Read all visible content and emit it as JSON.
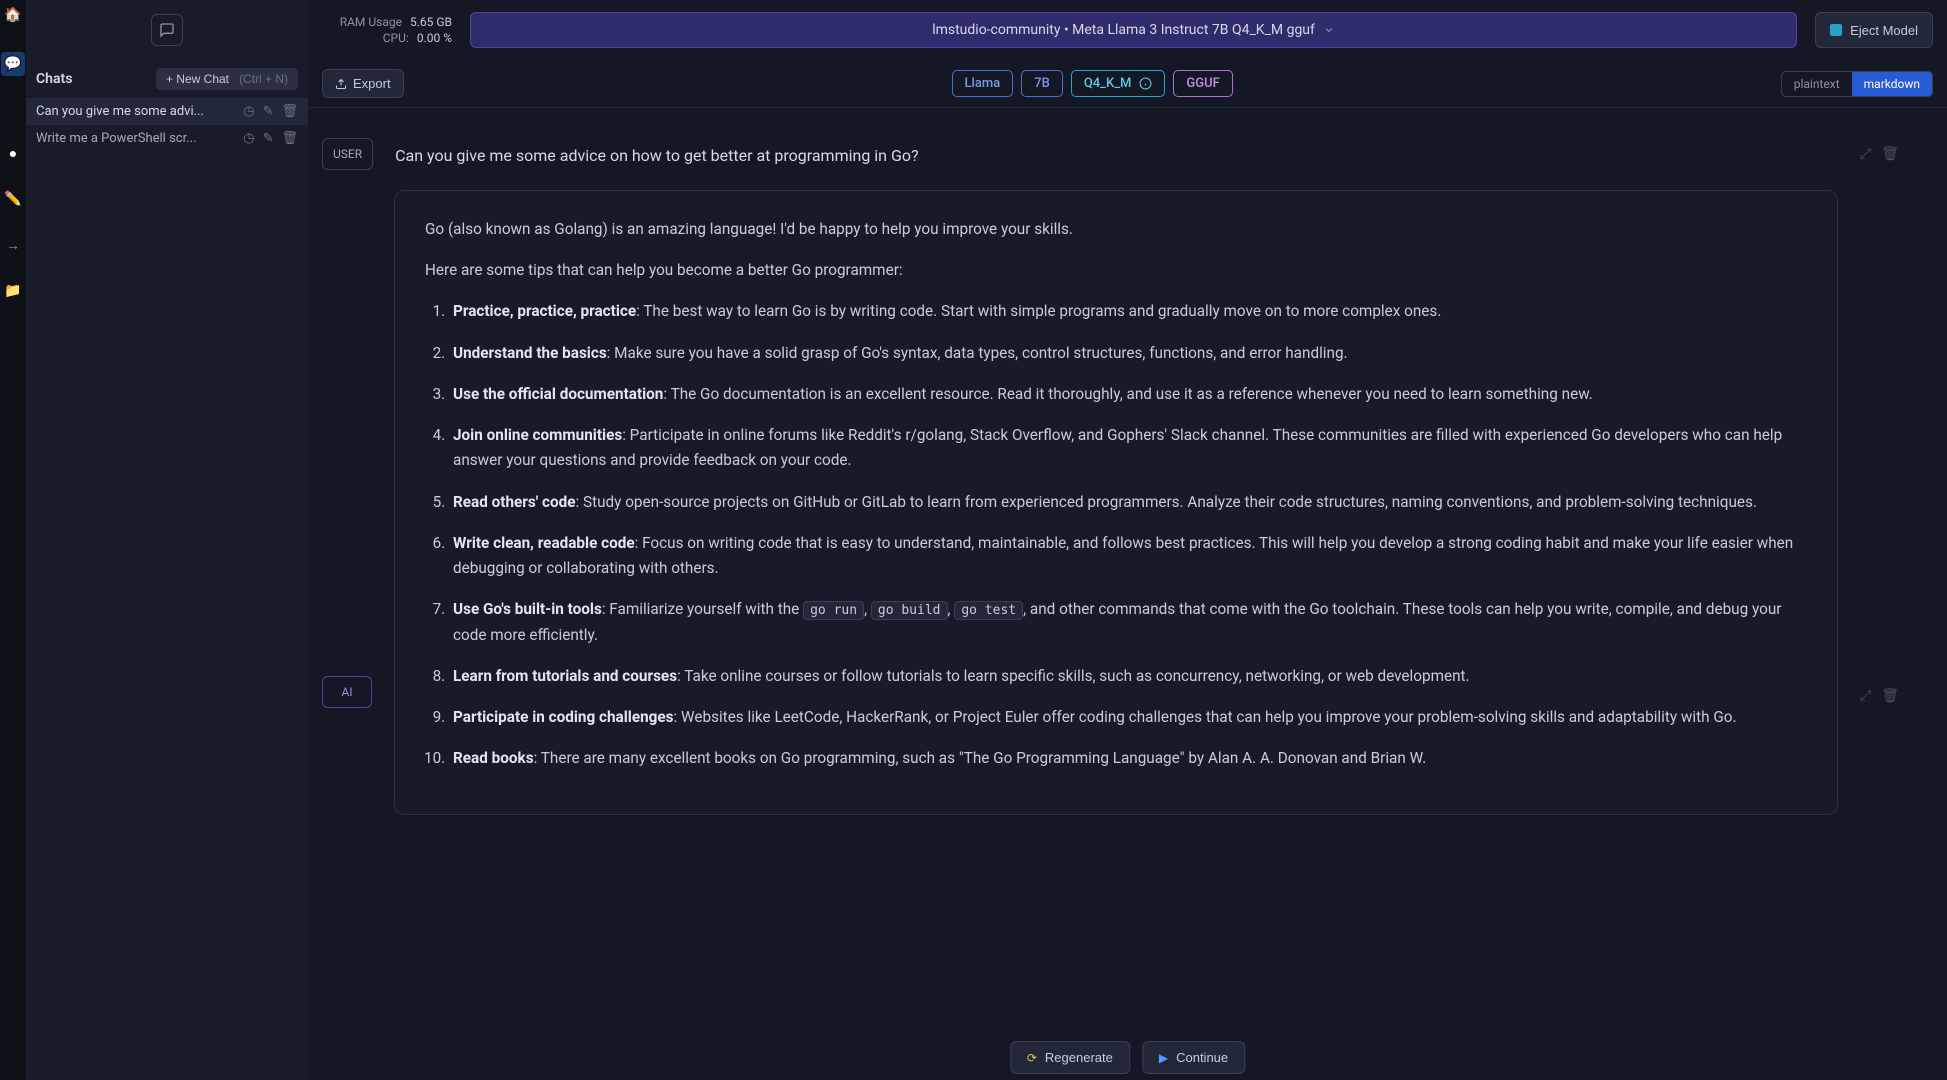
{
  "rail": {
    "items": [
      {
        "name": "home-icon",
        "glyph": "🏠"
      },
      {
        "name": "chat-icon",
        "glyph": "💬",
        "active": true
      },
      {
        "name": "bulb-icon",
        "glyph": "💡"
      },
      {
        "name": "edit-icon",
        "glyph": "✏️"
      },
      {
        "name": "arrow-icon",
        "glyph": "→"
      },
      {
        "name": "folder-icon",
        "glyph": "📁"
      }
    ]
  },
  "sidebar": {
    "title": "Chats",
    "new_chat_label": "+ New Chat",
    "new_chat_kbd": "(Ctrl + N)",
    "items": [
      {
        "label": "Can you give me some advi...",
        "active": true
      },
      {
        "label": "Write me a PowerShell scr..."
      }
    ]
  },
  "header": {
    "ram_label": "RAM Usage",
    "ram_value": "5.65 GB",
    "cpu_label": "CPU:",
    "cpu_value": "0.00 %",
    "model_label": "lmstudio-community • Meta Llama 3 Instruct 7B Q4_K_M gguf",
    "eject_label": "Eject Model"
  },
  "tags": {
    "export_label": "Export",
    "llama": "Llama",
    "sevenb": "7B",
    "quant": "Q4_K_M",
    "gguf": "GGUF",
    "view_plaintext": "plaintext",
    "view_markdown": "markdown"
  },
  "conversation": {
    "user_role": "USER",
    "ai_role": "AI",
    "user_text": "Can you give me some advice on how to get better at programming in Go?",
    "ai_intro1": "Go (also known as Golang) is an amazing language! I'd be happy to help you improve your skills.",
    "ai_intro2": "Here are some tips that can help you become a better Go programmer:",
    "tips": [
      {
        "title": "Practice, practice, practice",
        "body": ": The best way to learn Go is by writing code. Start with simple programs and gradually move on to more complex ones."
      },
      {
        "title": "Understand the basics",
        "body": ": Make sure you have a solid grasp of Go's syntax, data types, control structures, functions, and error handling."
      },
      {
        "title": "Use the official documentation",
        "body": ": The Go documentation is an excellent resource. Read it thoroughly, and use it as a reference whenever you need to learn something new."
      },
      {
        "title": "Join online communities",
        "body": ": Participate in online forums like Reddit's r/golang, Stack Overflow, and Gophers' Slack channel. These communities are filled with experienced Go developers who can help answer your questions and provide feedback on your code."
      },
      {
        "title": "Read others' code",
        "body": ": Study open-source projects on GitHub or GitLab to learn from experienced programmers. Analyze their code structures, naming conventions, and problem-solving techniques."
      },
      {
        "title": "Write clean, readable code",
        "body": ": Focus on writing code that is easy to understand, maintainable, and follows best practices. This will help you develop a strong coding habit and make your life easier when debugging or collaborating with others."
      },
      {
        "title": "Use Go's built-in tools",
        "body_pre": ": Familiarize yourself with the ",
        "codes": [
          "go run",
          "go build",
          "go test"
        ],
        "body_post": ", and other commands that come with the Go toolchain. These tools can help you write, compile, and debug your code more efficiently."
      },
      {
        "title": "Learn from tutorials and courses",
        "body": ": Take online courses or follow tutorials to learn specific skills, such as concurrency, networking, or web development."
      },
      {
        "title": "Participate in coding challenges",
        "body": ": Websites like LeetCode, HackerRank, or Project Euler offer coding challenges that can help you improve your problem-solving skills and adaptability with Go."
      },
      {
        "title": "Read books",
        "body": ": There are many excellent books on Go programming, such as \"The Go Programming Language\" by Alan A. A. Donovan and Brian W."
      }
    ]
  },
  "footer": {
    "regenerate_label": "Regenerate",
    "continue_label": "Continue"
  }
}
